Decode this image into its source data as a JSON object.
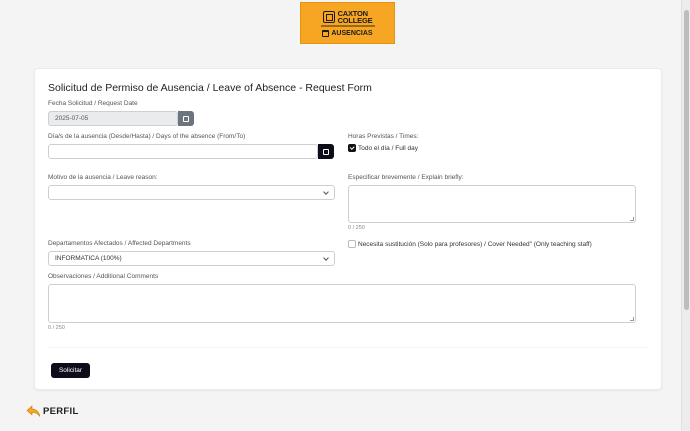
{
  "logo": {
    "name_line1": "CAXTON",
    "name_line2": "COLLEGE",
    "sub": "AUSENCIAS"
  },
  "form": {
    "title": "Solicitud de Permiso de Ausencia / Leave of Absence - Request Form",
    "request_date": {
      "label": "Fecha Solicitud / Request Date",
      "value": "2025-07-05"
    },
    "days": {
      "label": "Día/s de la ausencia (Desde/Hasta) / Days of the absence (From/To)",
      "value": ""
    },
    "times": {
      "label": "Horas Previstas / Times:",
      "full_day_label": "Todo el día / Full day",
      "full_day_checked": true
    },
    "reason": {
      "label": "Motivo de la ausencia / Leave reason:",
      "value": ""
    },
    "explain": {
      "label": "Especificar brevemente / Explain briefly:",
      "counter": "0 / 250"
    },
    "departments": {
      "label": "Departamentos Afectados / Affected Departments",
      "value": "INFORMATICA (100%)"
    },
    "cover": {
      "label": "Necesita sustitución (Solo para profesores) / Cover Needed\" (Only teaching staff)",
      "checked": false
    },
    "comments": {
      "label": "Observaciones / Additional Comments",
      "counter": "0 / 250"
    },
    "submit_label": "Solicitar"
  },
  "footer": {
    "perfil_label": "PERFIL"
  },
  "colors": {
    "accent": "#f6a623",
    "button": "#0d0d1a",
    "background": "#f4f4f5"
  }
}
